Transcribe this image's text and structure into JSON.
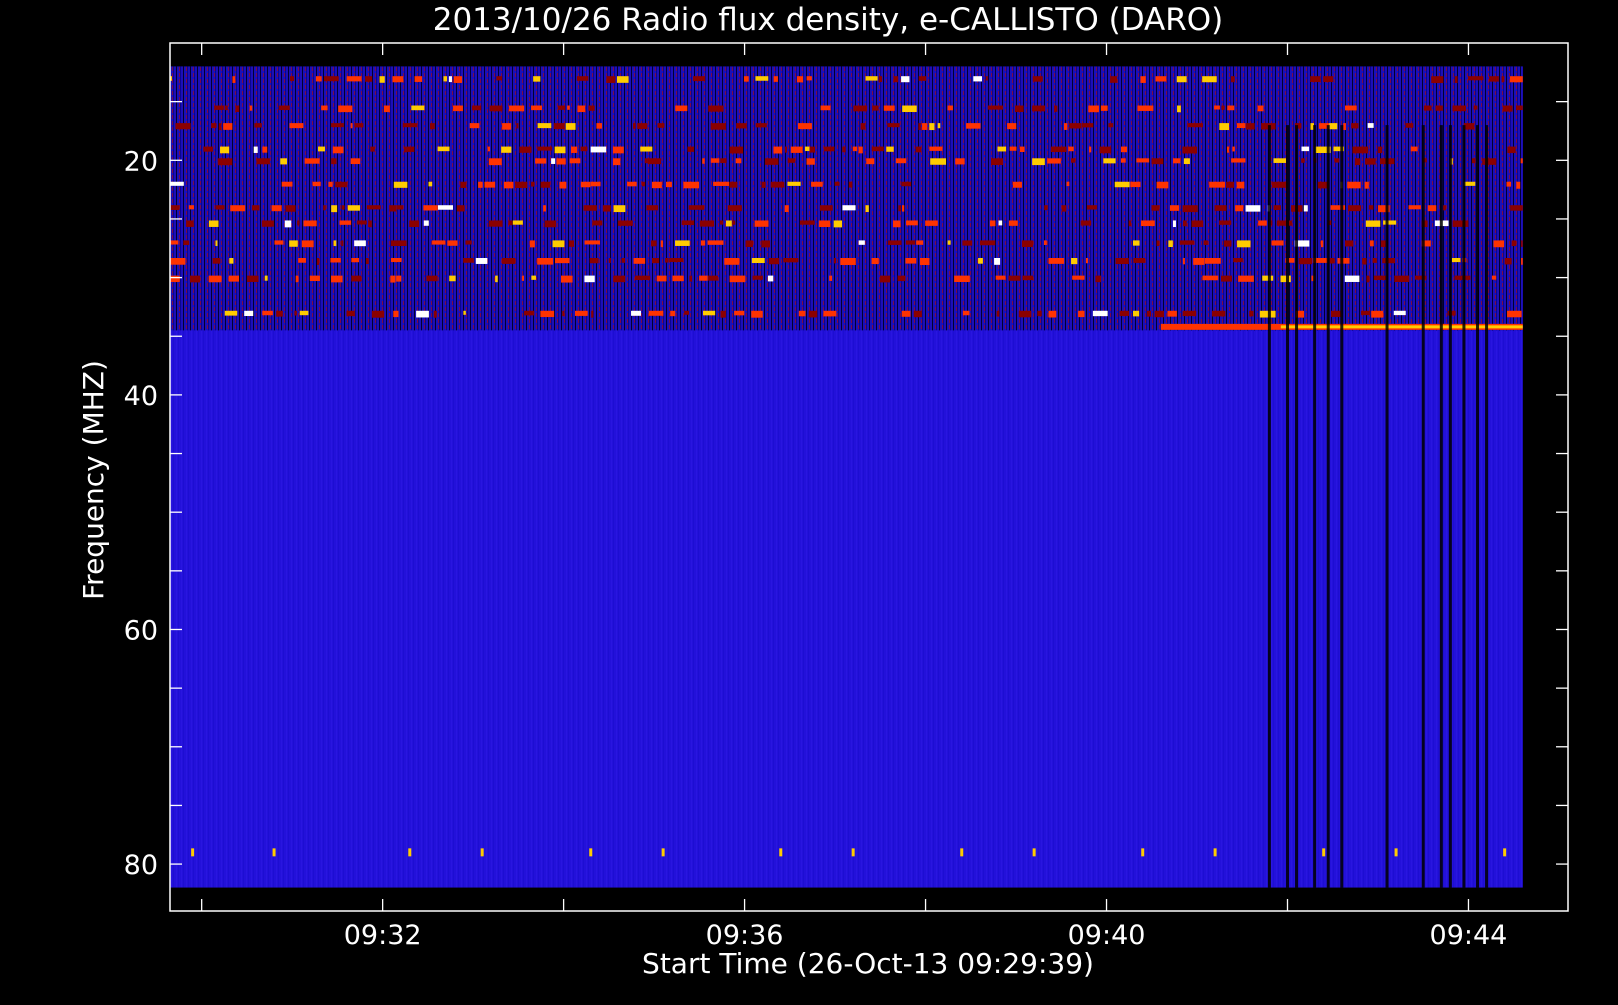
{
  "chart_data": {
    "type": "heatmap",
    "title": "2013/10/26  Radio flux density, e-CALLISTO (DARO)",
    "xlabel": "Start Time (26-Oct-13 09:29:39)",
    "ylabel": "Frequency (MHZ)",
    "x_ticks": [
      "09:32",
      "09:36",
      "09:40",
      "09:44"
    ],
    "x_tick_values_min": [
      152,
      156,
      160,
      164
    ],
    "x_minor_values_min": [
      150,
      154,
      158,
      162
    ],
    "x_range_min": [
      149.65,
      165.1
    ],
    "x_data_range_min": [
      149.65,
      164.6
    ],
    "y_ticks": [
      "20",
      "40",
      "60",
      "80"
    ],
    "y_tick_values": [
      20,
      40,
      60,
      80
    ],
    "y_minor_values": [
      15,
      25,
      30,
      35,
      45,
      50,
      55,
      65,
      70,
      75
    ],
    "ylim_top_to_bottom": [
      10,
      84
    ],
    "y_data_range": [
      12,
      82
    ],
    "y_inverted": true,
    "grid": false,
    "colormap": [
      "#000000",
      "#0000ff",
      "#8b0000",
      "#ff3300",
      "#ffcc00",
      "#ffffff"
    ],
    "background_color": "#1a10dd",
    "noisy_band_mhz": [
      12,
      34.5
    ],
    "features": {
      "emission_lines_mhz": [
        13,
        15.5,
        17,
        19,
        20,
        22,
        24,
        25.3,
        27,
        28.5,
        30,
        33
      ],
      "bright_line_34mhz": {
        "freq": 34.2,
        "start_min": 160.6,
        "end_min": 164.6
      },
      "dark_columns_min": [
        161.8,
        162.0,
        162.1,
        162.3,
        162.45,
        162.6,
        163.1,
        163.5,
        163.7,
        163.8,
        163.95,
        164.1,
        164.2
      ],
      "interference_marks_min": [
        149.9,
        150.8,
        152.3,
        153.1,
        154.3,
        155.1,
        156.4,
        157.2,
        158.4,
        159.2,
        160.4,
        161.2,
        162.4,
        163.2,
        164.4
      ],
      "interference_mark_freq": 79
    }
  }
}
